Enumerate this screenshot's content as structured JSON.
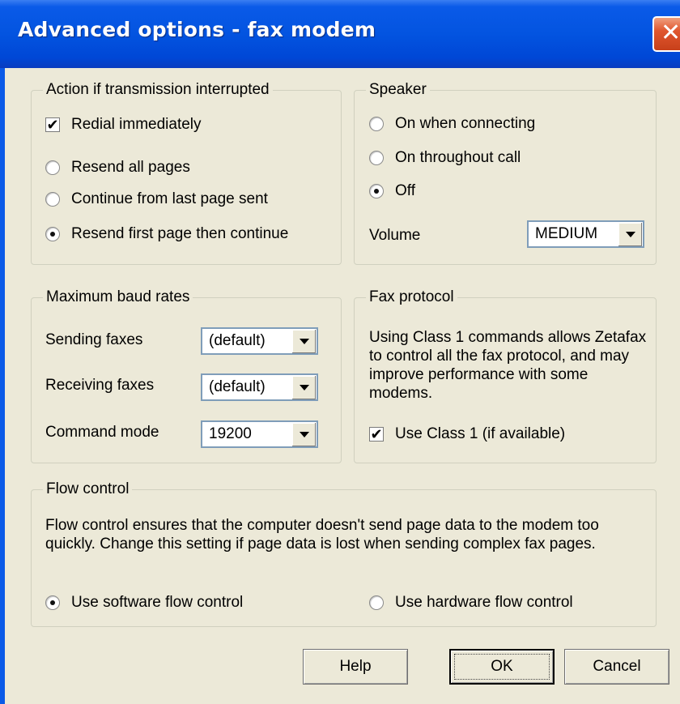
{
  "window": {
    "title": "Advanced options - fax modem",
    "close_glyph": "✕"
  },
  "transmission": {
    "group_label": "Action if transmission interrupted",
    "redial_label": "Redial immediately",
    "redial_checked": true,
    "options": [
      {
        "label": "Resend all pages",
        "selected": false
      },
      {
        "label": "Continue from last page sent",
        "selected": false
      },
      {
        "label": "Resend first page then continue",
        "selected": true
      }
    ]
  },
  "speaker": {
    "group_label": "Speaker",
    "options": [
      {
        "label": "On when connecting",
        "selected": false
      },
      {
        "label": "On throughout call",
        "selected": false
      },
      {
        "label": "Off",
        "selected": true
      }
    ],
    "volume_label": "Volume",
    "volume_value": "MEDIUM"
  },
  "baud": {
    "group_label": "Maximum baud rates",
    "sending_label": "Sending faxes",
    "sending_value": "(default)",
    "receiving_label": "Receiving faxes",
    "receiving_value": "(default)",
    "command_label": "Command mode",
    "command_value": "19200"
  },
  "protocol": {
    "group_label": "Fax protocol",
    "description": "Using Class 1 commands allows Zetafax to control all the fax protocol, and may improve performance with some modems.",
    "class1_label": "Use Class 1 (if available)",
    "class1_checked": true
  },
  "flow": {
    "group_label": "Flow control",
    "description": "Flow control ensures that the computer doesn't send page data to the modem too quickly.  Change this setting if page data is lost when sending complex fax pages.",
    "software_label": "Use software flow control",
    "software_selected": true,
    "hardware_label": "Use hardware flow control",
    "hardware_selected": false
  },
  "buttons": {
    "help": "Help",
    "ok": "OK",
    "cancel": "Cancel"
  },
  "glyphs": {
    "checkmark": "✔"
  }
}
